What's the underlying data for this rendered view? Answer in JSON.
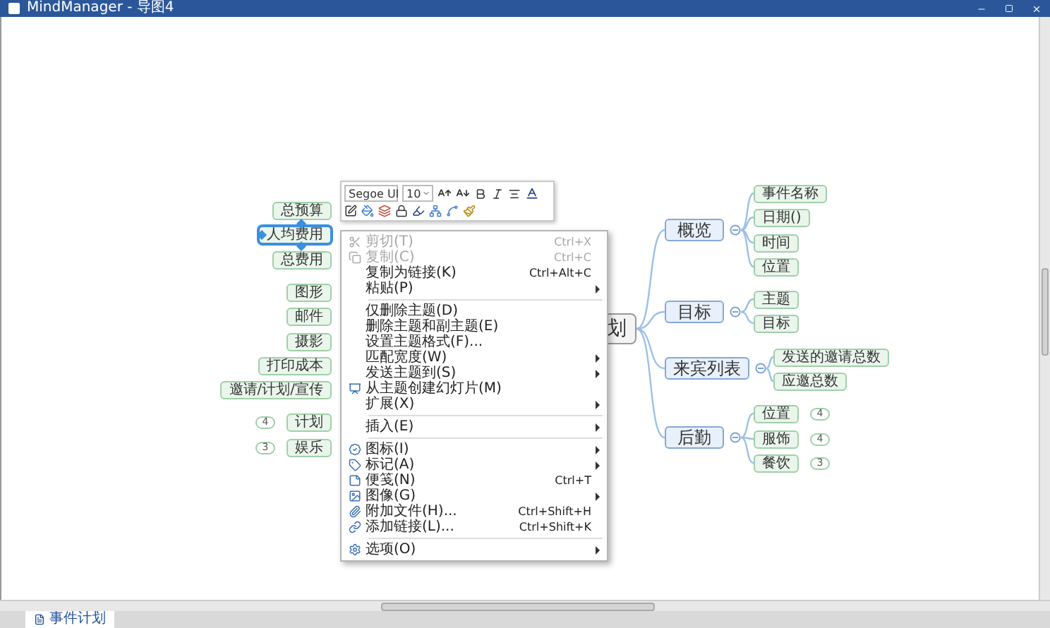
{
  "window": {
    "title": "MindManager - 导图4"
  },
  "map": {
    "central_topic": {
      "text": "划"
    },
    "left_topics": [
      {
        "text": "总预算",
        "selected": false
      },
      {
        "text": "人均费用",
        "selected": true
      },
      {
        "text": "总费用",
        "selected": false
      },
      {
        "text": "图形",
        "selected": false
      },
      {
        "text": "邮件",
        "selected": false
      },
      {
        "text": "摄影",
        "selected": false
      },
      {
        "text": "打印成本",
        "selected": false
      },
      {
        "text": "邀请/计划/宣传",
        "selected": false
      },
      {
        "text": "计划",
        "selected": false,
        "badge": "4"
      },
      {
        "text": "娱乐",
        "selected": false,
        "badge": "3"
      }
    ],
    "right_topics": [
      {
        "text": "概览",
        "children": [
          {
            "text": "事件名称"
          },
          {
            "text": "日期()"
          },
          {
            "text": "时间"
          },
          {
            "text": "位置"
          }
        ]
      },
      {
        "text": "目标",
        "children": [
          {
            "text": "主题"
          },
          {
            "text": "目标"
          }
        ]
      },
      {
        "text": "来宾列表",
        "children": [
          {
            "text": "发送的邀请总数"
          },
          {
            "text": "应邀总数"
          }
        ]
      },
      {
        "text": "后勤",
        "children": [
          {
            "text": "位置",
            "badge": "4"
          },
          {
            "text": "服饰",
            "badge": "4"
          },
          {
            "text": "餐饮",
            "badge": "3"
          }
        ]
      }
    ]
  },
  "format_toolbar": {
    "font": "Segoe UI",
    "size": "10"
  },
  "context_menu": [
    {
      "kind": "item",
      "label": "剪切(T)",
      "shortcut": "Ctrl+X",
      "disabled": true
    },
    {
      "kind": "item",
      "label": "复制(C)",
      "shortcut": "Ctrl+C",
      "disabled": true
    },
    {
      "kind": "item",
      "label": "复制为链接(K)",
      "shortcut": "Ctrl+Alt+C",
      "disabled": false
    },
    {
      "kind": "item",
      "label": "粘贴(P)",
      "disabled": false,
      "submenu": true
    },
    {
      "kind": "separator"
    },
    {
      "kind": "item",
      "label": "仅删除主题(D)",
      "disabled": false
    },
    {
      "kind": "item",
      "label": "删除主题和副主题(E)",
      "disabled": false
    },
    {
      "kind": "item",
      "label": "设置主题格式(F)...",
      "disabled": false
    },
    {
      "kind": "item",
      "label": "匹配宽度(W)",
      "disabled": false,
      "submenu": true
    },
    {
      "kind": "item",
      "label": "发送主题到(S)",
      "disabled": false,
      "submenu": true
    },
    {
      "kind": "item",
      "label": "从主题创建幻灯片(M)",
      "disabled": false
    },
    {
      "kind": "item",
      "label": "扩展(X)",
      "disabled": false,
      "submenu": true
    },
    {
      "kind": "separator"
    },
    {
      "kind": "item",
      "label": "插入(E)",
      "disabled": false,
      "submenu": true
    },
    {
      "kind": "separator"
    },
    {
      "kind": "item",
      "label": "图标(I)",
      "disabled": false,
      "submenu": true
    },
    {
      "kind": "item",
      "label": "标记(A)",
      "disabled": false,
      "submenu": true
    },
    {
      "kind": "item",
      "label": "便笺(N)",
      "shortcut": "Ctrl+T",
      "disabled": false
    },
    {
      "kind": "item",
      "label": "图像(G)",
      "disabled": false,
      "submenu": true
    },
    {
      "kind": "item",
      "label": "附加文件(H)...",
      "shortcut": "Ctrl+Shift+H",
      "disabled": false
    },
    {
      "kind": "item",
      "label": "添加链接(L)...",
      "shortcut": "Ctrl+Shift+K",
      "disabled": false
    },
    {
      "kind": "separator"
    },
    {
      "kind": "item",
      "label": "选项(O)",
      "disabled": false,
      "submenu": true
    }
  ],
  "tabs": [
    {
      "label": "事件计划",
      "selected": true
    }
  ]
}
